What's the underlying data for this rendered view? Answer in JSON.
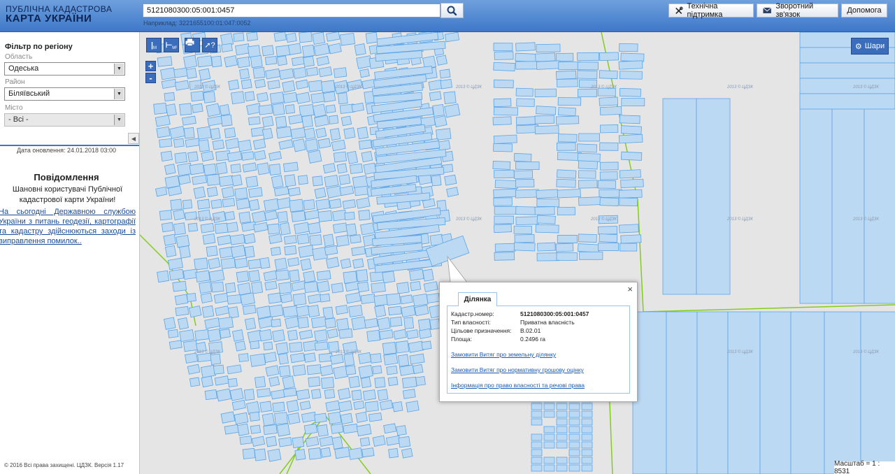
{
  "header": {
    "logo_line1": "ПУБЛІЧНА КАДАСТРОВА",
    "logo_line2": "КАРТА УКРАЇНИ",
    "search_value": "5121080300:05:001:0457",
    "search_example": "Наприклад: 3221655100:01:047:0052",
    "search_icon": "search-icon",
    "buttons": {
      "support": "Технічна підтримка",
      "feedback": "Зворотний зв'язок",
      "help": "Допомога"
    }
  },
  "sidebar": {
    "filter_title": "Фільтр по регіону",
    "region_label": "Область",
    "region_value": "Одеська",
    "district_label": "Район",
    "district_value": "Біляївський",
    "city_label": "Місто",
    "city_value": "- Всі -",
    "update_date": "Дата оновлення: 24.01.2018 03:00",
    "news_title": "Повідомлення",
    "news_greeting": "Шановні користувачі Публічної кадастрової карти України!",
    "news_link": "На сьогодні Державною службою України з питань геодезії, картографії та кадастру здійснюються заходи із виправлення помилок..",
    "copyright": "© 2016 Всі права захищені. ЦДЗК. Версія 1.17"
  },
  "map": {
    "layers_label": "Шари",
    "zoom_in": "+",
    "zoom_out": "-",
    "scale": "Масштаб = 1 : 8531",
    "watermark": "2013 © ЦДЗК",
    "tools": [
      {
        "icon": "measure-length-icon",
        "label": "М"
      },
      {
        "icon": "measure-area-icon",
        "label": "М²"
      },
      {
        "icon": "print-icon",
        "label": ""
      },
      {
        "icon": "help-cursor-icon",
        "label": ""
      }
    ],
    "parcel_fill": "#bcd9f3",
    "parcel_stroke": "#5aa3e6",
    "boundary_color": "#84cc1c"
  },
  "popup": {
    "tab_label": "Ділянка",
    "close": "×",
    "fields": [
      {
        "key": "Кадастр.номер:",
        "value": "5121080300:05:001:0457",
        "bold": true
      },
      {
        "key": "Тип власності:",
        "value": "Приватна власність",
        "bold": false
      },
      {
        "key": "Цільове призначення:",
        "value": "В.02.01",
        "bold": false
      },
      {
        "key": "Площа:",
        "value": "0.2496 га",
        "bold": false
      }
    ],
    "links": [
      "Замовити Витяг про земельну ділянку",
      "Замовити Витяг про нормативну грошову оцінку",
      "Інформація про право власності та речові права"
    ]
  }
}
